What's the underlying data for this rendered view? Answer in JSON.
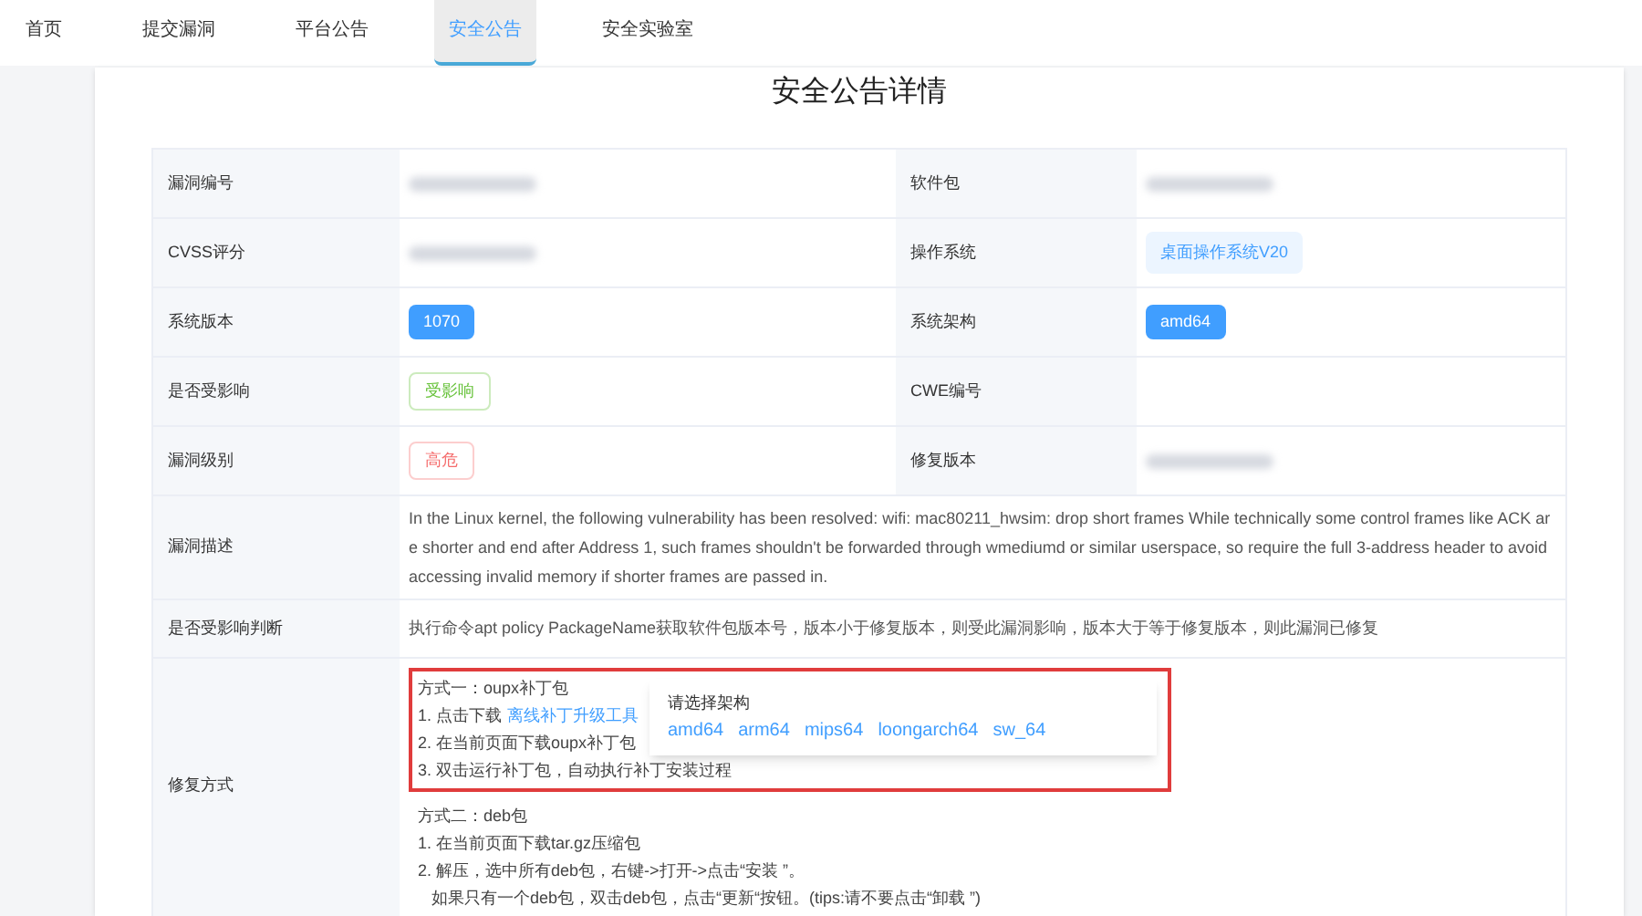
{
  "nav": [
    {
      "label": "首页",
      "selected": false
    },
    {
      "label": "提交漏洞",
      "selected": false
    },
    {
      "label": "平台公告",
      "selected": false
    },
    {
      "label": "安全公告",
      "selected": true
    },
    {
      "label": "安全实验室",
      "selected": false
    }
  ],
  "title": "安全公告详情",
  "grid_rows": [
    [
      {
        "label": "漏洞编号",
        "value": {
          "kind": "redacted"
        }
      },
      {
        "label": "软件包",
        "value": {
          "kind": "redacted"
        }
      }
    ],
    [
      {
        "label": "CVSS评分",
        "value": {
          "kind": "redacted"
        }
      },
      {
        "label": "操作系统",
        "value": {
          "kind": "light",
          "text": "桌面操作系统V20"
        }
      }
    ],
    [
      {
        "label": "系统版本",
        "value": {
          "kind": "solid",
          "text": "1070"
        }
      },
      {
        "label": "系统架构",
        "value": {
          "kind": "solid",
          "text": "amd64"
        }
      }
    ],
    [
      {
        "label": "是否受影响",
        "value": {
          "kind": "outline",
          "text": "受影响",
          "color": "#67c23a"
        }
      },
      {
        "label": "CWE编号",
        "value": {
          "kind": "empty"
        }
      }
    ],
    [
      {
        "label": "漏洞级别",
        "value": {
          "kind": "outline",
          "text": "高危",
          "color": "#f56c6c"
        }
      },
      {
        "label": "修复版本",
        "value": {
          "kind": "redacted"
        }
      }
    ]
  ],
  "description": {
    "label": "漏洞描述",
    "text": "In the Linux kernel, the following vulnerability has been resolved: wifi: mac80211_hwsim: drop short frames While technically some control frames like ACK are shorter and end after Address 1, such frames shouldn't be forwarded through wmediumd or similar userspace, so require the full 3-address header to avoid accessing invalid memory if shorter frames are passed in."
  },
  "judgement": {
    "label": "是否受影响判断",
    "text": "执行命令apt policy PackageName获取软件包版本号，版本小于修复版本，则受此漏洞影响，版本大于等于修复版本，则此漏洞已修复"
  },
  "fix": {
    "label": "修复方式",
    "method_1": {
      "title": "方式一：oupx补丁包",
      "step_1_text": "1. 点击下载",
      "step_1_link": "离线补丁升级工具",
      "steps": [
        "2. 在当前页面下载oupx补丁包",
        "3. 双击运行补丁包，自动执行补丁安装过程"
      ]
    },
    "popup": {
      "title": "请选择架构",
      "options": [
        "amd64",
        "arm64",
        "mips64",
        "loongarch64",
        "sw_64"
      ]
    },
    "method_2": {
      "title": "方式二：deb包",
      "lines": [
        "1. 在当前页面下载tar.gz压缩包",
        "2. 解压，选中所有deb包，右键->打开->点击“安装 ”。",
        "   如果只有一个deb包，双击deb包，点击“更新“按钮。(tips:请不要点击“卸载 ”)"
      ]
    }
  }
}
